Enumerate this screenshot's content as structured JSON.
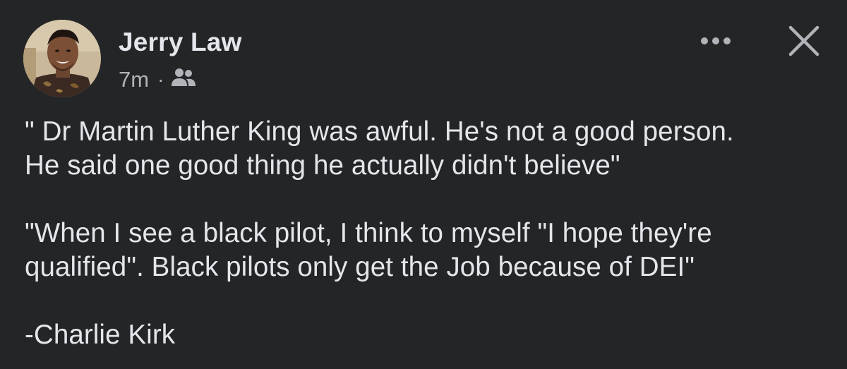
{
  "post": {
    "author": "Jerry Law",
    "time": "7m",
    "separator": "·",
    "audience_icon": "friends-icon",
    "more_icon": "more-options-icon",
    "close_icon": "close-icon",
    "paragraphs": [
      "\" Dr Martin Luther King was awful. He's not a good person.\nHe said one good thing he actually didn't believe\"",
      "\"When I see a black pilot, I think to myself \"I hope they're\nqualified\". Black pilots only get the Job because of DEI\"",
      "-Charlie Kirk"
    ]
  },
  "colors": {
    "background": "#242526",
    "primary_text": "#e4e6eb",
    "secondary_text": "#b0b3b8"
  }
}
